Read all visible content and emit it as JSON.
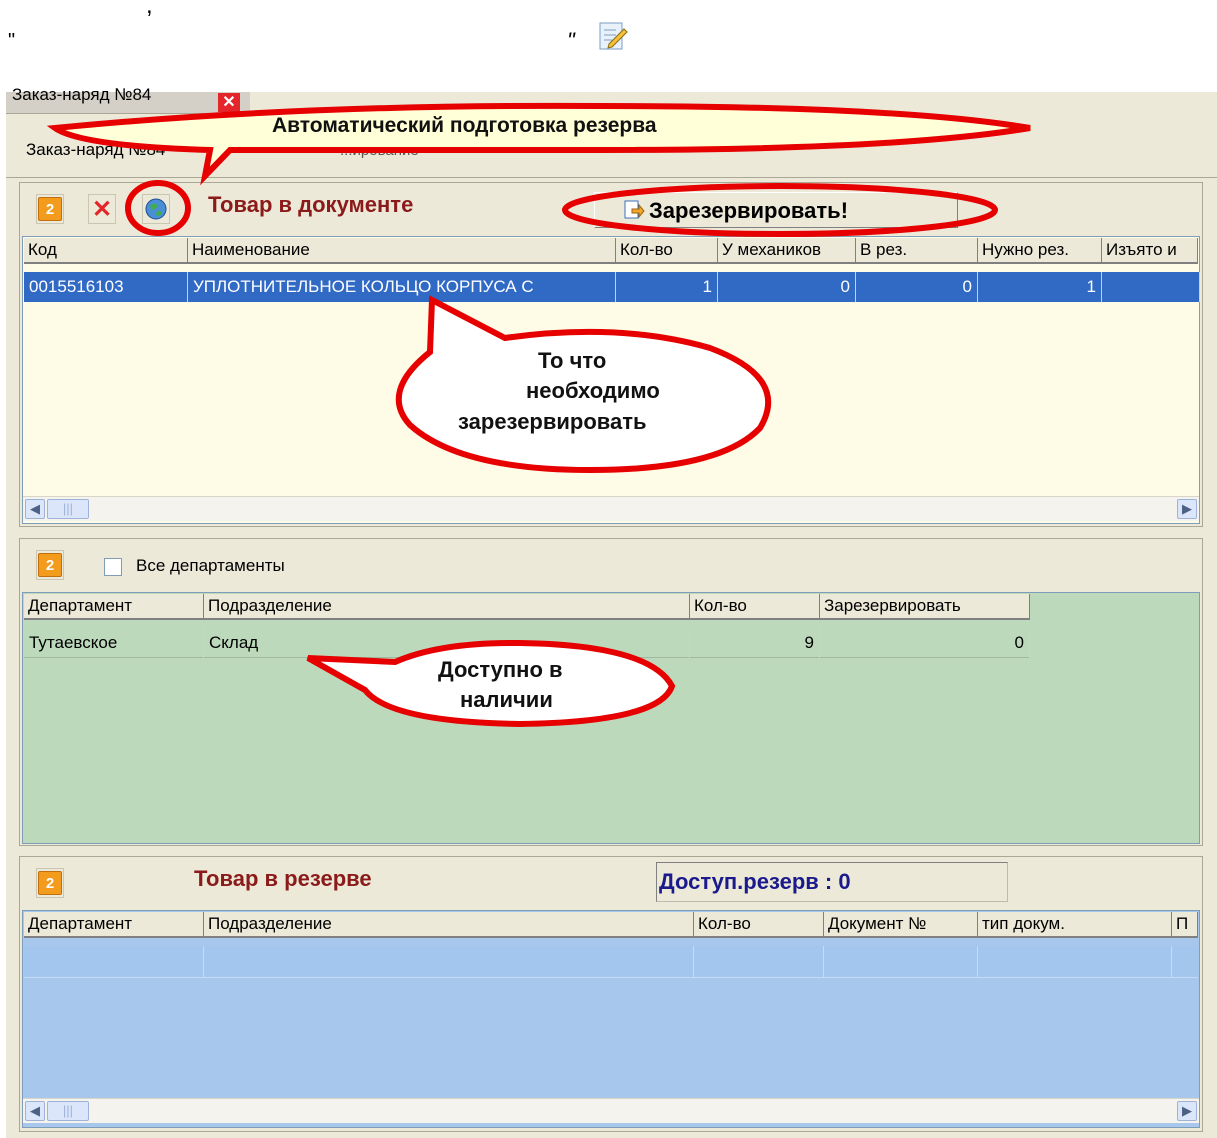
{
  "heading": {
    "quote_open": "\"",
    "quote_close": "\"",
    "comma": ","
  },
  "tab": {
    "label": "Заказ-наряд №84"
  },
  "subtabs": {
    "left": "Заказ-наряд №84",
    "right": "...ирование"
  },
  "top_grid": {
    "title": "Товар в документе",
    "reserve_button": "Зарезервировать!",
    "columns": [
      "Код",
      "Наименование",
      "Кол-во",
      "У механиков",
      "В рез.",
      "Нужно рез.",
      "Изъято и"
    ],
    "rows": [
      {
        "code": "0015516103",
        "name": "УПЛОТНИТЕЛЬНОЕ КОЛЬЦО КОРПУСА С",
        "qty": "1",
        "mech": "0",
        "inres": "0",
        "need": "1",
        "taken": ""
      }
    ]
  },
  "middle_grid": {
    "checkbox_label": "Все департаменты",
    "columns": [
      "Департамент",
      "Подразделение",
      "Кол-во",
      "Зарезервировать"
    ],
    "rows": [
      {
        "dept": "Тутаевское",
        "sub": "Склад",
        "qty": "9",
        "reserve": "0"
      }
    ]
  },
  "bottom_grid": {
    "title": "Товар в резерве",
    "available_label": "Доступ.резерв : 0",
    "columns": [
      "Департамент",
      "Подразделение",
      "Кол-во",
      "Документ №",
      "тип докум.",
      "П"
    ]
  },
  "callouts": {
    "auto": "Автоматический подготовка резерва",
    "need_line1": "То что",
    "need_line2": "необходимо",
    "need_line3": "зарезервировать",
    "avail_line1": "Доступно в",
    "avail_line2": "наличии"
  },
  "colors": {
    "selected_row": "#316ac5",
    "top_bg": "#fefbe6",
    "mid_bg": "#bcd9bc",
    "bottom_bg": "#a7c8ec",
    "annotation": "#e60000"
  }
}
